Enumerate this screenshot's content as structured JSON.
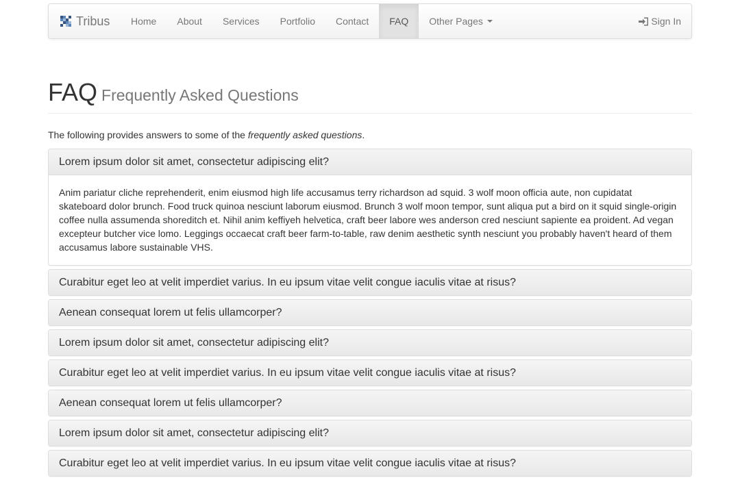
{
  "brand": {
    "name": "Tribus",
    "logo_colors": [
      "#37557e",
      "#5b87b8",
      "#9eb9d8",
      "#d5e2f0"
    ]
  },
  "nav": {
    "items": [
      {
        "label": "Home"
      },
      {
        "label": "About"
      },
      {
        "label": "Services"
      },
      {
        "label": "Portfolio"
      },
      {
        "label": "Contact"
      },
      {
        "label": "FAQ",
        "active": true
      },
      {
        "label": "Other Pages",
        "dropdown": true
      }
    ],
    "signin_label": "Sign In",
    "signin_icon": "sign-in-icon"
  },
  "header": {
    "title": "FAQ",
    "subtitle": "Frequently Asked Questions"
  },
  "intro": {
    "text_before": "The following provides answers to some of the ",
    "emphasis": "frequently asked questions",
    "text_after": "."
  },
  "faq": [
    {
      "question": "Lorem ipsum dolor sit amet, consectetur adipiscing elit?",
      "answer": "Anim pariatur cliche reprehenderit, enim eiusmod high life accusamus terry richardson ad squid. 3 wolf moon officia aute, non cupidatat skateboard dolor brunch. Food truck quinoa nesciunt laborum eiusmod. Brunch 3 wolf moon tempor, sunt aliqua put a bird on it squid single-origin coffee nulla assumenda shoreditch et. Nihil anim keffiyeh helvetica, craft beer labore wes anderson cred nesciunt sapiente ea proident. Ad vegan excepteur butcher vice lomo. Leggings occaecat craft beer farm-to-table, raw denim aesthetic synth nesciunt you probably haven't heard of them accusamus labore sustainable VHS.",
      "open": true
    },
    {
      "question": "Curabitur eget leo at velit imperdiet varius. In eu ipsum vitae velit congue iaculis vitae at risus?"
    },
    {
      "question": "Aenean consequat lorem ut felis ullamcorper?"
    },
    {
      "question": "Lorem ipsum dolor sit amet, consectetur adipiscing elit?"
    },
    {
      "question": "Curabitur eget leo at velit imperdiet varius. In eu ipsum vitae velit congue iaculis vitae at risus?"
    },
    {
      "question": "Aenean consequat lorem ut felis ullamcorper?"
    },
    {
      "question": "Lorem ipsum dolor sit amet, consectetur adipiscing elit?"
    },
    {
      "question": "Curabitur eget leo at velit imperdiet varius. In eu ipsum vitae velit congue iaculis vitae at risus?"
    }
  ]
}
